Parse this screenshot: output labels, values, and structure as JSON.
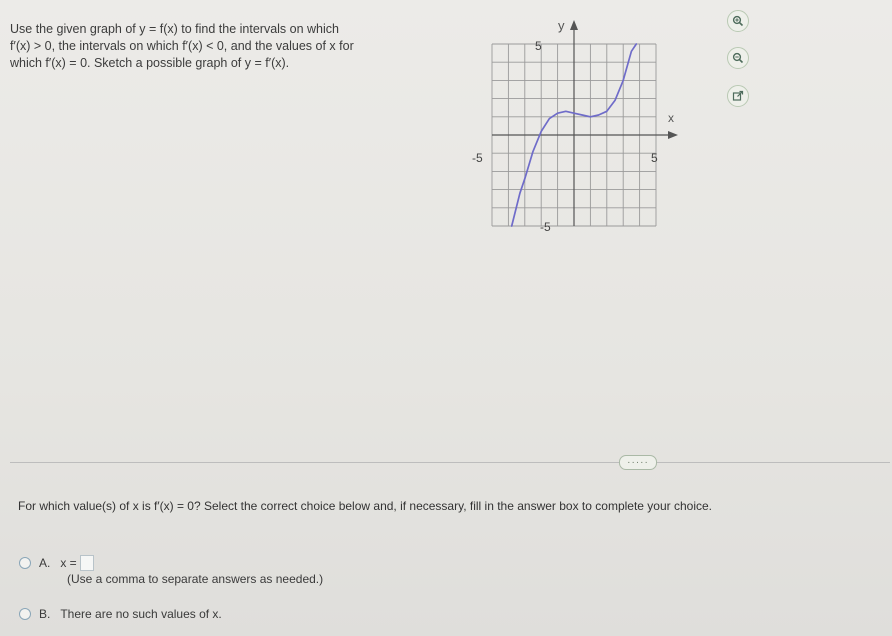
{
  "prompt": {
    "line1": "Use the given graph of y = f(x) to find the intervals on which",
    "line2": "f′(x) > 0, the intervals on which f′(x) < 0, and the values of x for",
    "line3": "which f′(x) = 0. Sketch a possible graph of y = f′(x)."
  },
  "graph": {
    "y_axis_label": "y",
    "x_axis_label": "x",
    "tick_y_top": "5",
    "tick_y_bottom": "-5",
    "tick_x_left": "-5",
    "tick_x_right": "5",
    "curve_color": "#6f6cc9"
  },
  "chart_data": {
    "type": "line",
    "xlim": [
      -5,
      5
    ],
    "ylim": [
      -5,
      5
    ],
    "grid": true,
    "series": [
      {
        "x": [
          -3.8,
          -3.3,
          -3,
          -2.5,
          -2,
          -1.5,
          -1,
          -0.5,
          0,
          0.5,
          1,
          1.5,
          2,
          2.5,
          3,
          3.5,
          3.8
        ],
        "y": [
          -5,
          -3.2,
          -2.4,
          -0.9,
          0.2,
          0.9,
          1.2,
          1.3,
          1.2,
          1.1,
          1,
          1.1,
          1.3,
          1.9,
          3,
          4.6,
          5
        ]
      }
    ]
  },
  "tools": {
    "zoom_in": "zoom-in",
    "zoom_out": "zoom-out",
    "popout": "popout"
  },
  "divider": {
    "more_label": "·····"
  },
  "question": {
    "text": "For which value(s) of x is f′(x) = 0? Select the correct choice below and, if necessary, fill in the answer box to complete your choice."
  },
  "choices": {
    "a_letter": "A.",
    "a_text": "x =",
    "a_hint": "(Use a comma to separate answers as needed.)",
    "b_letter": "B.",
    "b_text": "There are no such values of x."
  }
}
